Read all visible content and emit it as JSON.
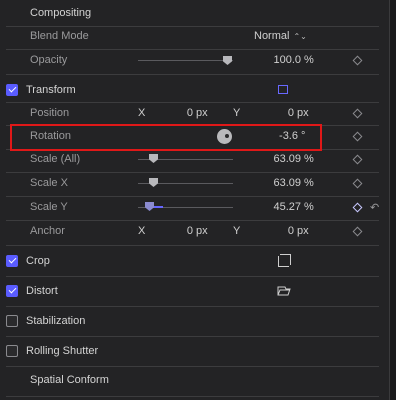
{
  "sections": {
    "compositing": {
      "title": "Compositing"
    },
    "transform": {
      "title": "Transform",
      "checked": true
    },
    "crop": {
      "title": "Crop",
      "checked": true
    },
    "distort": {
      "title": "Distort",
      "checked": true
    },
    "stabilization": {
      "title": "Stabilization",
      "checked": false
    },
    "rolling_shutter": {
      "title": "Rolling Shutter",
      "checked": false
    },
    "spatial_conform": {
      "title": "Spatial Conform"
    }
  },
  "compositing": {
    "blend_mode": {
      "label": "Blend Mode",
      "value": "Normal",
      "chevrons": "⌃⌄"
    },
    "opacity": {
      "label": "Opacity",
      "value": "100.0",
      "unit": "%",
      "level": 1.0
    }
  },
  "transform": {
    "position": {
      "label": "Position",
      "x_axis": "X",
      "x_value": "0",
      "x_unit": "px",
      "y_axis": "Y",
      "y_value": "0",
      "y_unit": "px"
    },
    "rotation": {
      "label": "Rotation",
      "value": "-3.6",
      "unit": "°"
    },
    "scale_all": {
      "label": "Scale (All)",
      "value": "63.09",
      "unit": "%"
    },
    "scale_x": {
      "label": "Scale X",
      "value": "63.09",
      "unit": "%"
    },
    "scale_y": {
      "label": "Scale Y",
      "value": "45.27",
      "unit": "%"
    },
    "anchor": {
      "label": "Anchor",
      "x_axis": "X",
      "x_value": "0",
      "x_unit": "px",
      "y_axis": "Y",
      "y_value": "0",
      "y_unit": "px"
    },
    "reset_glyph": "↶"
  }
}
